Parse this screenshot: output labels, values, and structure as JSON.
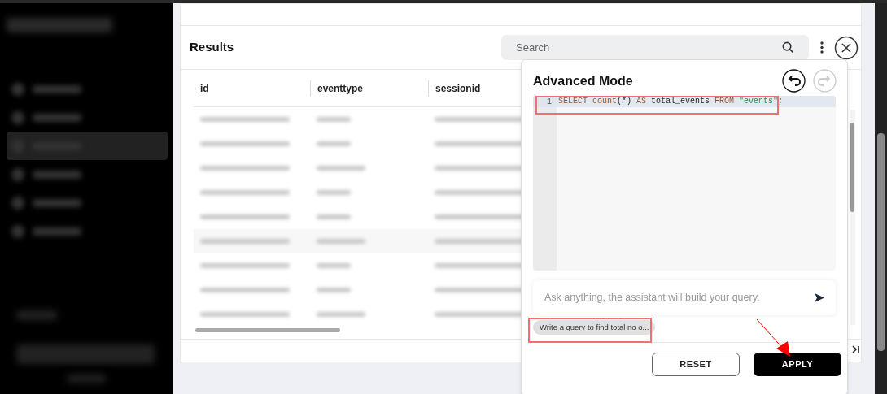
{
  "sidebar": {
    "items": [
      {
        "selected": false
      },
      {
        "selected": false
      },
      {
        "selected": true
      },
      {
        "selected": false
      },
      {
        "selected": false
      },
      {
        "selected": false
      }
    ]
  },
  "results": {
    "title": "Results",
    "search": {
      "placeholder": "Search"
    },
    "table": {
      "columns": [
        "id",
        "eventtype",
        "sessionid"
      ]
    }
  },
  "advanced_mode": {
    "title": "Advanced Mode",
    "undo": {
      "disabled": false
    },
    "redo": {
      "disabled": true
    },
    "editor": {
      "lines": [
        {
          "number": "1",
          "tokens": [
            {
              "kind": "keyword",
              "text": "SELECT "
            },
            {
              "kind": "function",
              "text": "count"
            },
            {
              "kind": "plain",
              "text": "(*) "
            },
            {
              "kind": "keyword",
              "text": "AS "
            },
            {
              "kind": "plain",
              "text": "total_events "
            },
            {
              "kind": "keyword",
              "text": "FROM "
            },
            {
              "kind": "string",
              "text": "\"events\""
            },
            {
              "kind": "plain",
              "text": ";"
            }
          ]
        }
      ]
    },
    "assistant": {
      "placeholder": "Ask anything, the assistant will build your query."
    },
    "suggestions": [
      "Write a query to find total no o..."
    ],
    "buttons": [
      {
        "label": "RESET",
        "kind": "outline"
      },
      {
        "label": "APPLY",
        "kind": "primary"
      }
    ]
  }
}
